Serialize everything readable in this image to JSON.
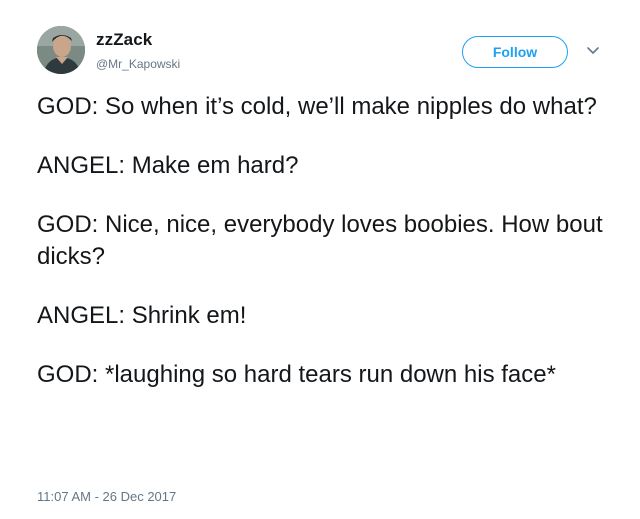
{
  "user": {
    "display_name": "zzZack",
    "handle": "@Mr_Kapowski"
  },
  "follow_label": "Follow",
  "icons": {
    "avatar": "avatar-photo",
    "more": "chevron-down-icon"
  },
  "colors": {
    "accent": "#1da1f2",
    "text": "#14171a",
    "muted": "#657786"
  },
  "tweet": {
    "paragraphs": [
      "GOD: So when it’s cold, we’ll make nipples do what?",
      "ANGEL: Make em hard?",
      "GOD: Nice, nice, everybody loves boobies. How bout dicks?",
      "ANGEL: Shrink em!",
      "GOD: *laughing so hard tears run down his face*"
    ],
    "timestamp": "11:07 AM - 26 Dec 2017"
  }
}
